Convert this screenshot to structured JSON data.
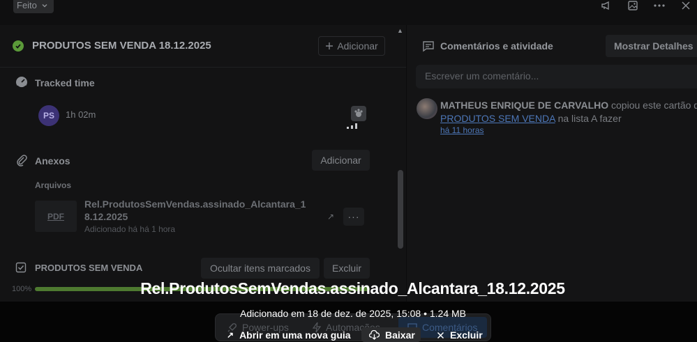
{
  "topbar": {
    "status_label": "Feito",
    "icons": [
      "megaphone-icon",
      "image-icon",
      "more-icon",
      "close-icon"
    ]
  },
  "card": {
    "title": "PRODUTOS SEM VENDA 18.12.2025",
    "add_button": "Adicionar"
  },
  "tracked_time": {
    "title": "Tracked time",
    "avatar_initials": "PS",
    "duration": "1h 02m"
  },
  "attachments": {
    "title": "Anexos",
    "add_button": "Adicionar",
    "files_label": "Arquivos",
    "file": {
      "type_label": "PDF",
      "name": "Rel.ProdutosSemVendas.assinado_Alcantara_18.12.2025",
      "added": "Adicionado há há 1 hora"
    }
  },
  "checklist": {
    "title": "PRODUTOS SEM VENDA",
    "hide_button": "Ocultar itens marcados",
    "delete_button": "Excluir",
    "percent_label": "100%",
    "progress": 1.0
  },
  "activity": {
    "title": "Comentários e atividade",
    "details_button": "Mostrar Detalhes",
    "comment_placeholder": "Escrever um comentário...",
    "entry": {
      "author": "MATHEUS ENRIQUE DE CARVALHO",
      "action": "copiou este cartão de",
      "link": "PRODUTOS SEM VENDA",
      "suffix": "na lista A fazer",
      "time": "há 11 horas"
    }
  },
  "dock": {
    "powerups": "Power-ups",
    "automations": "Automações",
    "comments": "Comentários"
  },
  "preview": {
    "title": "Rel.ProdutosSemVendas.assinado_Alcantara_18.12.2025",
    "meta": "Adicionado em 18 de dez. de 2025, 15:08 • 1.24 MB",
    "open_new_tab": "Abrir em uma nova guia",
    "download": "Baixar",
    "delete": "Excluir"
  },
  "colors": {
    "success": "#5b9a39",
    "link": "#4d77b8",
    "progress": "#4e7a30"
  }
}
